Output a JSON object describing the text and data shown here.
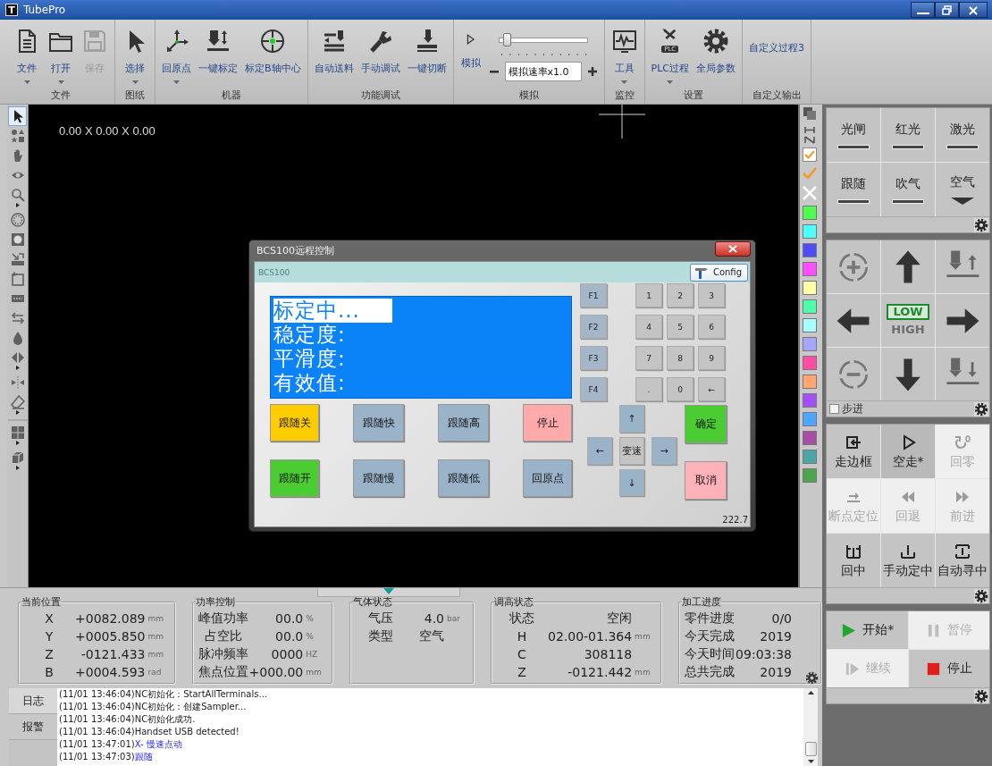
{
  "window": {
    "logo": "T",
    "title": "TubePro"
  },
  "ribbon": {
    "groups": [
      {
        "label": "文件",
        "kind": "buttons",
        "buttons": [
          {
            "label": "文件",
            "kind": "file",
            "dropdown": true,
            "disabled": false
          },
          {
            "label": "打开",
            "kind": "folder",
            "dropdown": true,
            "disabled": false
          },
          {
            "label": "保存",
            "kind": "save",
            "dropdown": false,
            "disabled": true
          }
        ]
      },
      {
        "label": "图纸",
        "kind": "buttons",
        "buttons": [
          {
            "label": "选择",
            "kind": "pointer",
            "dropdown": true,
            "disabled": false
          }
        ]
      },
      {
        "label": "机器",
        "kind": "buttons",
        "buttons": [
          {
            "label": "回原点",
            "kind": "origin",
            "dropdown": true,
            "disabled": false
          },
          {
            "label": "一键标定",
            "kind": "calibrate",
            "dropdown": false,
            "disabled": false
          },
          {
            "label": "标定B轴中心",
            "kind": "center",
            "dropdown": false,
            "disabled": false
          }
        ]
      },
      {
        "label": "功能调试",
        "kind": "buttons",
        "buttons": [
          {
            "label": "自动送料",
            "kind": "feed",
            "dropdown": false,
            "disabled": false
          },
          {
            "label": "手动调试",
            "kind": "manual",
            "dropdown": false,
            "disabled": false
          },
          {
            "label": "一键切断",
            "kind": "cut",
            "dropdown": false,
            "disabled": false
          }
        ]
      },
      {
        "label": "模拟",
        "kind": "simulation",
        "buttons": [
          {
            "label": "模拟",
            "kind": "play",
            "dropdown": false,
            "disabled": false
          }
        ],
        "speed_slider": {
          "level": 0.08
        },
        "speed_field": {
          "value": "模拟速率x1.0"
        }
      },
      {
        "label": "监控",
        "kind": "buttons",
        "buttons": [
          {
            "label": "工具",
            "kind": "monitor",
            "dropdown": true,
            "disabled": false
          }
        ]
      },
      {
        "label": "设置",
        "kind": "buttons",
        "buttons": [
          {
            "label": "PLC过程",
            "kind": "plc",
            "badge": "PLC",
            "dropdown": true,
            "disabled": false
          },
          {
            "label": "全局参数",
            "kind": "gear",
            "dropdown": false,
            "disabled": false
          }
        ]
      },
      {
        "label": "自定义输出",
        "kind": "buttons",
        "buttons": [
          {
            "label": "自定义过程3",
            "kind": "text",
            "dropdown": false,
            "disabled": false
          }
        ]
      }
    ]
  },
  "tools": [
    {
      "kind": "pointer",
      "selected": true,
      "submenu": false
    },
    {
      "kind": "shapes",
      "selected": false,
      "submenu": false
    },
    {
      "kind": "hand",
      "selected": false,
      "submenu": false
    },
    {
      "kind": "eye",
      "selected": false,
      "submenu": false
    },
    {
      "kind": "zoom",
      "selected": false,
      "submenu": true
    },
    {
      "kind": "dotted-circle",
      "selected": false,
      "submenu": false
    },
    {
      "kind": "circle-square",
      "selected": false,
      "submenu": false
    },
    {
      "kind": "scale",
      "selected": false,
      "submenu": false
    },
    {
      "kind": "frame",
      "selected": false,
      "submenu": false
    },
    {
      "kind": "dashed-bar",
      "selected": false,
      "submenu": false
    },
    {
      "kind": "swap",
      "selected": false,
      "submenu": false
    },
    {
      "kind": "drop",
      "selected": false,
      "submenu": false
    },
    {
      "kind": "mirror",
      "selected": false,
      "submenu": true
    },
    {
      "kind": "align",
      "selected": false,
      "submenu": false
    },
    {
      "kind": "eraser",
      "selected": false,
      "submenu": true
    },
    {
      "kind": "grid",
      "selected": false,
      "submenu": true
    },
    {
      "kind": "cube",
      "selected": false,
      "submenu": true
    }
  ],
  "canvas": {
    "coordinates": "0.00 X 0.00 X 0.00"
  },
  "layer_column": {
    "show_all_checked": true,
    "colors": [
      {
        "color": "#4dff4d"
      },
      {
        "color": "#4dffff"
      },
      {
        "color": "#4d4dff"
      },
      {
        "color": "#ff4dff"
      },
      {
        "color": "#ffffa6"
      },
      {
        "color": "#4dffa6"
      },
      {
        "color": "#a6ffff"
      },
      {
        "color": "#a6a6ff"
      },
      {
        "color": "#ff4da6"
      },
      {
        "color": "#ffa673"
      },
      {
        "color": "#a64dff"
      },
      {
        "color": "#4da6ff"
      },
      {
        "color": "#a64da6"
      },
      {
        "color": "#4da6a6"
      },
      {
        "color": "#4da64d"
      }
    ]
  },
  "dialog": {
    "title": "BCS100远程控制",
    "header": "BCS100",
    "config": "Config",
    "screen": [
      {
        "text": "标定中...",
        "highlight": true
      },
      {
        "text": "稳定度:",
        "highlight": false
      },
      {
        "text": "平滑度:",
        "highlight": false
      },
      {
        "text": "有效值:",
        "highlight": false
      }
    ],
    "function_keys": [
      "F1",
      "F2",
      "F3",
      "F4"
    ],
    "keypad": [
      "1",
      "2",
      "3",
      "4",
      "5",
      "6",
      "7",
      "8",
      "9",
      ".",
      "0",
      "←"
    ],
    "actions": [
      {
        "label": "跟随关",
        "color": "#ffcc00"
      },
      {
        "label": "跟随快",
        "color": "#9ab3c9"
      },
      {
        "label": "跟随高",
        "color": "#9ab3c9"
      },
      {
        "label": "停止",
        "color": "#ffaaaa"
      },
      {
        "label": "跟随开",
        "color": "#4ccc33"
      },
      {
        "label": "跟随慢",
        "color": "#9ab3c9"
      },
      {
        "label": "跟随低",
        "color": "#9ab3c9"
      },
      {
        "label": "回原点",
        "color": "#9ab3c9"
      }
    ],
    "arrows": {
      "up": "↑",
      "left": "←",
      "center": "变速",
      "right": "→",
      "down": "↓"
    },
    "confirm": "确定",
    "cancel": "取消",
    "footer": "222.7"
  },
  "status_panels": [
    {
      "title": "当前位置",
      "rows": [
        {
          "label": "X",
          "value": "+0082.089",
          "unit": "mm"
        },
        {
          "label": "Y",
          "value": "+0005.850",
          "unit": "mm"
        },
        {
          "label": "Z",
          "value": "-0121.433",
          "unit": "mm"
        },
        {
          "label": "B",
          "value": "+0004.593",
          "unit": "rad"
        }
      ]
    },
    {
      "title": "功率控制",
      "rows": [
        {
          "label": "峰值功率",
          "value": "00.0",
          "unit": "%"
        },
        {
          "label": "占空比",
          "value": "00.0",
          "unit": "%"
        },
        {
          "label": "脉冲频率",
          "value": "0000",
          "unit": "HZ"
        },
        {
          "label": "焦点位置",
          "value": "+000.00",
          "unit": "mm"
        }
      ]
    },
    {
      "title": "气体状态",
      "rows": [
        {
          "label": "气压",
          "value": "4.0",
          "unit": "bar"
        },
        {
          "label": "类型",
          "value": "空气"
        }
      ]
    },
    {
      "title": "调高状态",
      "rows": [
        {
          "label": "状态",
          "value": "空闲"
        },
        {
          "label": "H",
          "value": "02.00-01.364",
          "unit": "mm"
        },
        {
          "label": "C",
          "value": "308118"
        },
        {
          "label": "Z",
          "value": "-0121.442",
          "unit": "mm"
        }
      ]
    },
    {
      "title": "加工进度",
      "rows": [
        {
          "label": "零件进度",
          "value": "0/0"
        },
        {
          "label": "今天完成",
          "value": "2019"
        },
        {
          "label": "今天时间",
          "value": "09:03:38"
        },
        {
          "label": "总共完成",
          "value": "2019"
        }
      ]
    }
  ],
  "log": {
    "tabs": [
      {
        "label": "日志",
        "selected": true
      },
      {
        "label": "报警",
        "selected": false
      }
    ],
    "lines": [
      {
        "time": "(11/01 13:46:04)",
        "text": "NC初始化：StartAllTerminals...",
        "kind": "system"
      },
      {
        "time": "(11/01 13:46:04)",
        "text": "NC初始化：创建Sampler...",
        "kind": "system"
      },
      {
        "time": "(11/01 13:46:04)",
        "text": "NC初始化成功.",
        "kind": "system"
      },
      {
        "time": "(11/01 13:46:04)",
        "text": "Handset USB detected!",
        "kind": "system"
      },
      {
        "time": "(11/01 13:47:01)",
        "text": "X- 慢速点动",
        "kind": "command"
      },
      {
        "time": "(11/01 13:47:03)",
        "text": "跟随",
        "kind": "command"
      }
    ]
  },
  "switches": [
    {
      "label": "光闸",
      "kind": "toggle",
      "on": false
    },
    {
      "label": "红光",
      "kind": "toggle",
      "on": false
    },
    {
      "label": "激光",
      "kind": "toggle",
      "on": false
    },
    {
      "label": "跟随",
      "kind": "toggle",
      "on": false
    },
    {
      "label": "吹气",
      "kind": "toggle",
      "on": false
    },
    {
      "label": "空气",
      "kind": "menu"
    }
  ],
  "jog": {
    "speed": [
      {
        "label": "LOW",
        "selected": true
      },
      {
        "label": "HIGH",
        "selected": false
      }
    ],
    "step": {
      "label": "步进",
      "checked": false
    }
  },
  "functions": [
    {
      "label": "走边框",
      "kind": "frame",
      "disabled": false
    },
    {
      "label": "空走*",
      "kind": "dry-run",
      "disabled": false
    },
    {
      "label": "回零",
      "kind": "zero",
      "disabled": true
    },
    {
      "label": "断点定位",
      "kind": "breakpoint",
      "disabled": true
    },
    {
      "label": "回退",
      "kind": "back",
      "disabled": true
    },
    {
      "label": "前进",
      "kind": "forward",
      "disabled": true
    },
    {
      "label": "回中",
      "kind": "center",
      "disabled": false
    },
    {
      "label": "手动定中",
      "kind": "manual-center",
      "disabled": false
    },
    {
      "label": "自动寻中",
      "kind": "auto-center",
      "disabled": false
    }
  ],
  "run_controls": [
    {
      "label": "开始*",
      "kind": "start",
      "disabled": false
    },
    {
      "label": "暂停",
      "kind": "pause",
      "disabled": true
    },
    {
      "label": "继续",
      "kind": "resume",
      "disabled": true
    },
    {
      "label": "停止",
      "kind": "stop",
      "disabled": false
    }
  ]
}
